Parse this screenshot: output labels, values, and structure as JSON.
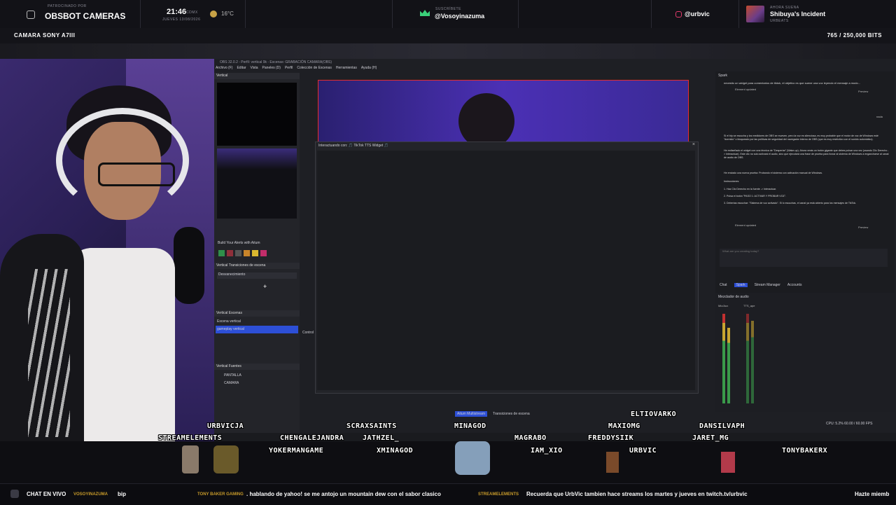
{
  "topbar": {
    "sponsor_label": "PATROCINADO POR",
    "brand": "OBSBOT CAMERAS",
    "time": "21:46",
    "time_zone": "CDMX",
    "date": "JUEVES 13/08/2026",
    "temperature": "16°C",
    "follow_label": "SUSCRÍBETE",
    "follow_handle": "@Vosoyinazuma",
    "instagram": "@urbvic",
    "music_label": "AHORA SUENA",
    "song": "Shibuya's Incident",
    "artist": "URBEATS"
  },
  "camera_bar": {
    "label": "CAMARA SONY A7III",
    "bits": "765 / 250,000 BITS"
  },
  "obs": {
    "title": "OBS 32.0.2 - Perfil: vertical 9k - Escenas: GRABACIÓN CAMARA(OBS)",
    "menu": [
      "Archivo (F)",
      "Editar",
      "Vista",
      "Paneles (D)",
      "Perfil",
      "Colección de Escenas",
      "Herramientas",
      "Ayuda (H)"
    ],
    "vertical_panel": "Vertical",
    "alerts_label": "Build Your Alerts with Aitum",
    "transitions_header": "Vertical Transiciones de escena",
    "transition_value": "Desvanecimiento",
    "scenes_header": "Vertical Escenas",
    "scenes": [
      "Escena vertical",
      "gameplay vertical"
    ],
    "sources_header": "Vertical Fuentes",
    "sources": [
      "PANTALLA",
      "CAMARA"
    ],
    "controls_label": "Control",
    "dialog_title": "Interactuando con: 🎵 TikTok TTS Widget 🎵",
    "bottom_tabs": [
      "Aitum Multistream",
      "Transiciones de escena"
    ],
    "status": "CPU: 5.2%   60.00 / 60.00 FPS"
  },
  "spark": {
    "title": "Spark",
    "prompt": "necesito un widget para comentarios de tiktok, el objetivo es que suene una voz leyendo el mensaje a modo...",
    "element_updated": "Element updated",
    "preview": "Preview",
    "user_msg": "nada",
    "para1": "Si el bip se escucha y los medidores de OBS se mueven, pero la voz es silenciosa, es muy probable que el motor de voz de Windows esté \"dormido\" o bloqueado por las políticas de seguridad del navegador interno de OBS (que es muy restrictivo con el sonido automático).",
    "para2": "He rediseñado el widget con una técnica de \"Despertar\" (Wake-up). Ahora verás un botón gigante que debes pulsar una vez (usando Clic Derecho -> Interactuar). Este clic no solo activará el audio, sino que ejecutará una frase de prueba para forzar al sistema de Windows a engancharse al canal de audio de OBS.",
    "para3": "He enviado una nueva prueba: Probando el sistema con activación manual de Windows.",
    "instructions_label": "Instrucciones:",
    "steps": [
      "1. Haz Clic Derecho en la fuente -> Interactuar.",
      "2. Pulsa el botón \"PASO 1: ACTIVAR Y PROBAR VOZ\".",
      "3. Deberías escuchar: \"Sistema de voz activado\". Si lo escuchas, el canal ya está abierto para los mensajes de TikTok."
    ],
    "input_placeholder": "What are you creating today?",
    "tabs": [
      "Chat",
      "Spark",
      "Stream Manager",
      "Accounts"
    ],
    "mixer_header": "Mezclador de audio",
    "mixer_channels": [
      "Mic/Aux",
      "TTS_ape"
    ]
  },
  "chat_names": [
    "URBVICJA",
    "SCRAXSAINTS",
    "MINAGOD",
    "ELTIOVARKO",
    "MAXIOMG",
    "DANSILVAPH",
    "STREAMELEMENTS",
    "CHENGALEJANDRA",
    "JATHZEL_",
    "MAGRABO",
    "FREDDYSIIK",
    "JARET_MG",
    "YOKERMANGAME",
    "XMINAGOD",
    "IAM_XIO",
    "URBVIC",
    "TONYBAKERX"
  ],
  "ticker": {
    "live_label": "CHAT EN VIVO",
    "items": [
      {
        "user": "VOSOYINAZUMA",
        "text": "bip"
      },
      {
        "user": "TONY BAKER GAMING",
        "text": ". hablando de yahoo! se me antojo un mountain dew con el sabor clasico"
      },
      {
        "user": "STREAMELEMENTS",
        "text": "Recuerda que UrbVic tambien hace streams los martes y jueves en twitch.tv/urbvic"
      },
      {
        "user": "",
        "text": "Hazte miemb"
      }
    ]
  },
  "colors": {
    "accent": "#5a3cc9",
    "scene_selected": "#2d4fd6",
    "record_red": "#e52d2d",
    "ticker_highlight": "#c89b2a"
  }
}
